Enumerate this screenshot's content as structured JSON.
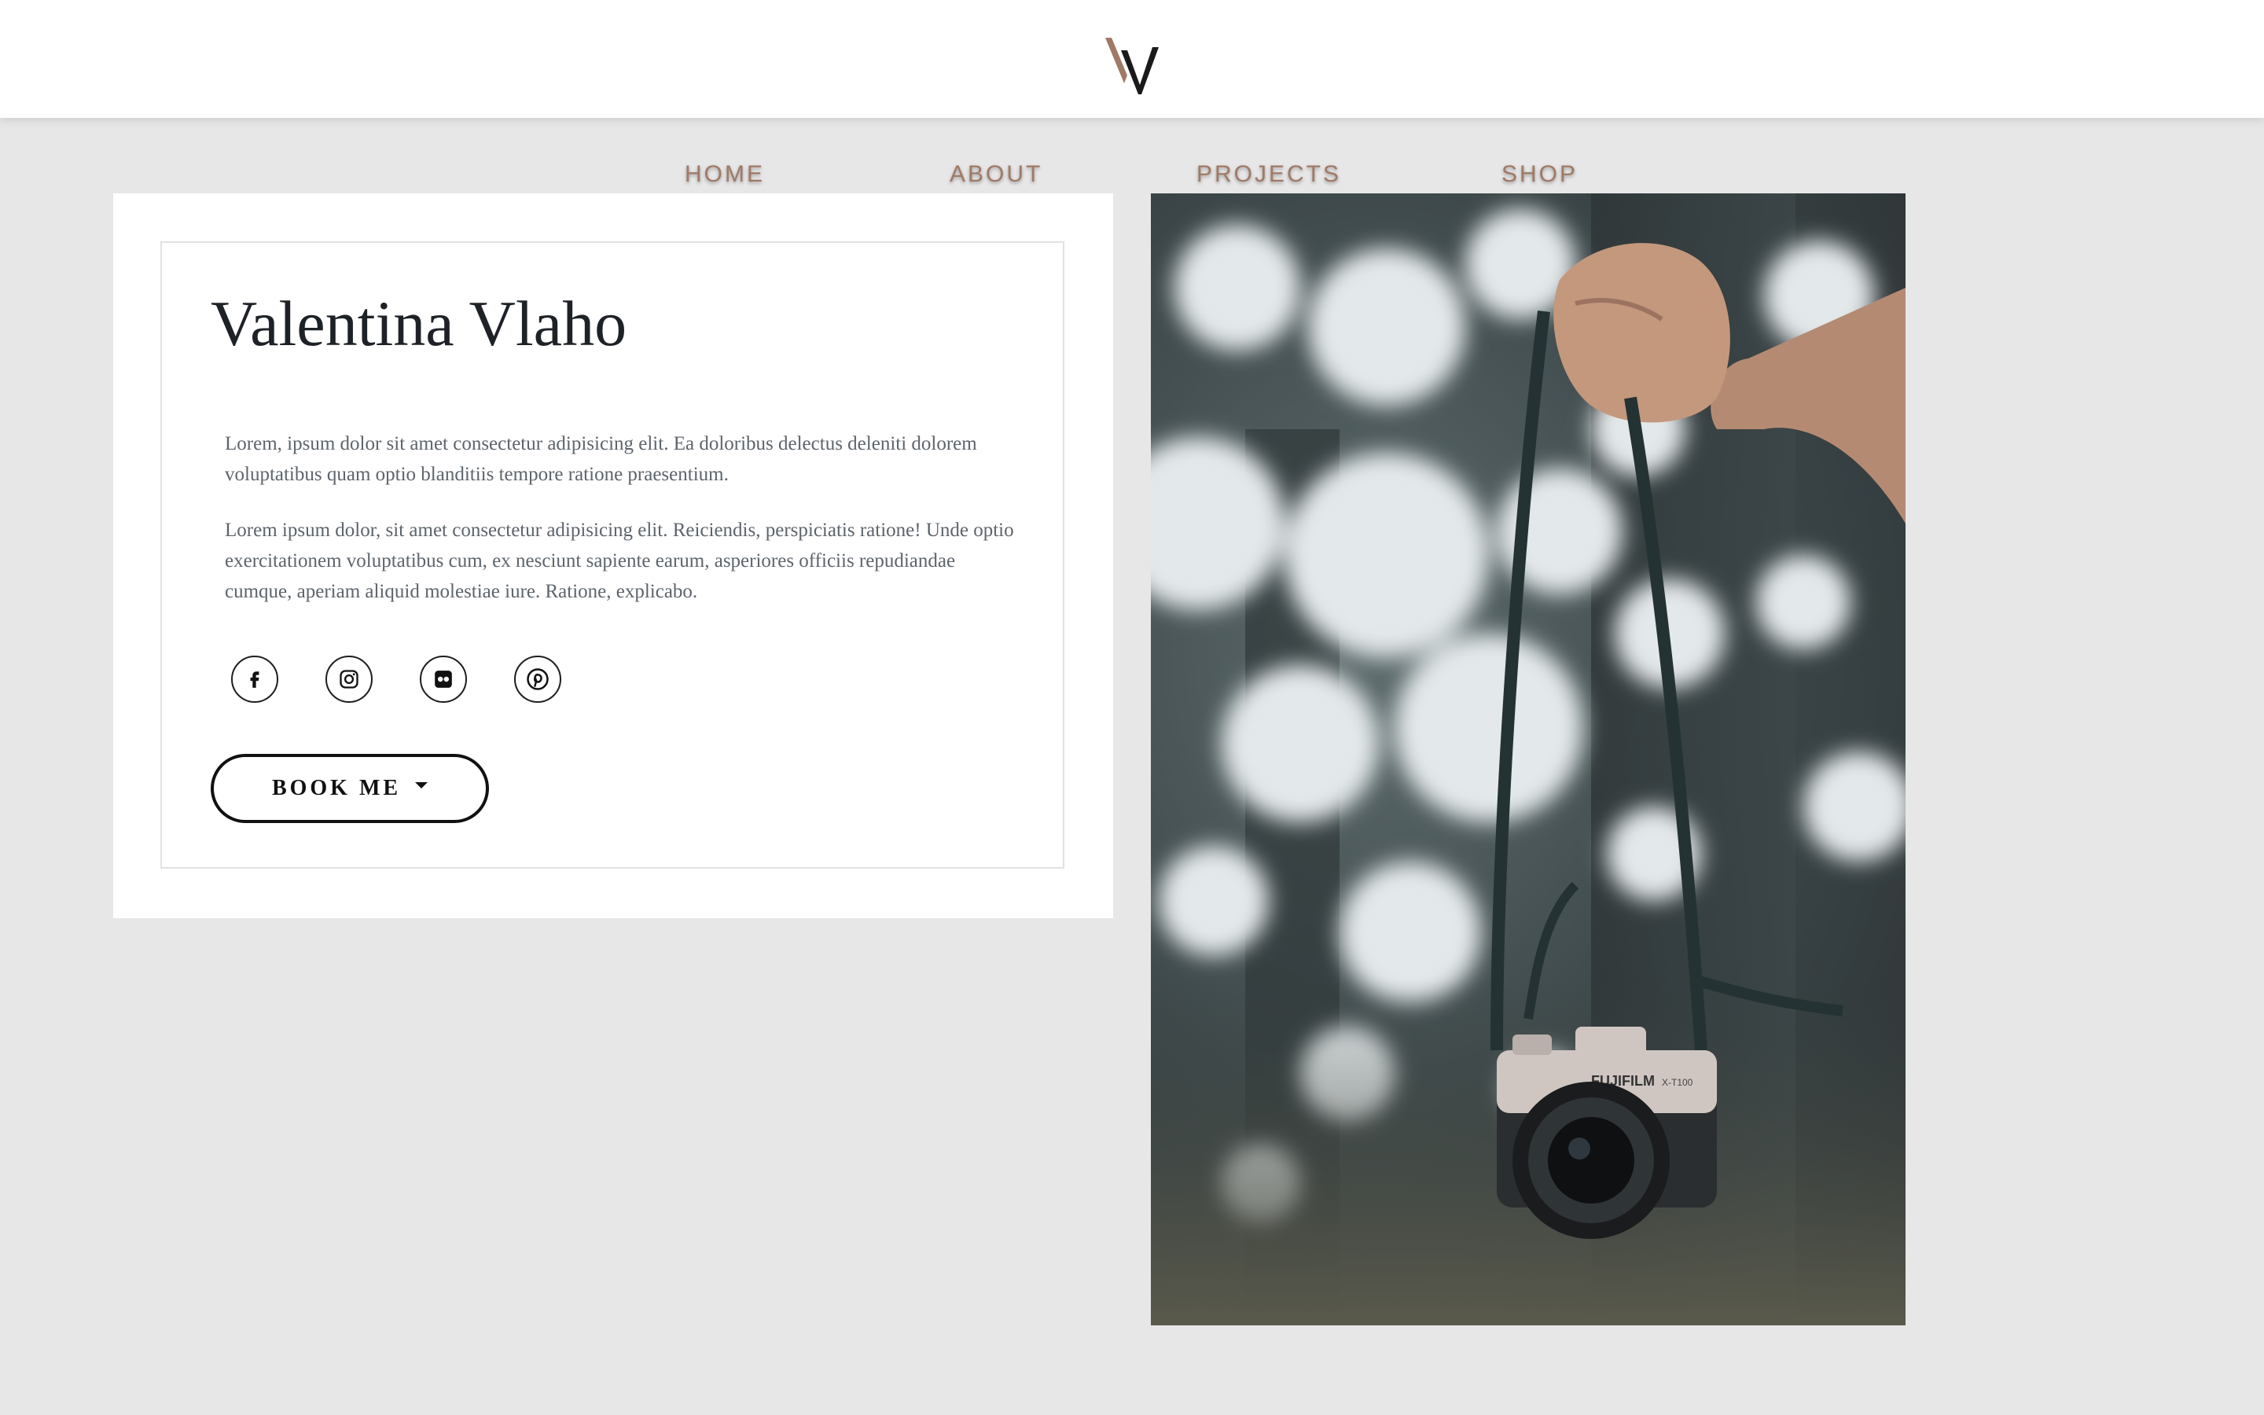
{
  "header": {
    "logo_icon": "vv-monogram-logo",
    "logo_colors": {
      "accent": "#a07a66",
      "dark": "#1a1a1a"
    }
  },
  "nav": {
    "items": [
      {
        "label": "HOME"
      },
      {
        "label": "ABOUT"
      },
      {
        "label": "PROJECTS"
      },
      {
        "label": "SHOP"
      }
    ],
    "color": "#a07a66"
  },
  "profile": {
    "name": "Valentina Vlaho",
    "paragraphs": [
      "Lorem, ipsum dolor sit amet consectetur adipisicing elit. Ea doloribus delectus deleniti dolorem voluptatibus quam optio blanditiis tempore ratione praesentium.",
      "Lorem ipsum dolor, sit amet consectetur adipisicing elit. Reiciendis, perspiciatis ratione! Unde optio exercitationem voluptatibus cum, ex nesciunt sapiente earum, asperiores officiis repudiandae cumque, aperiam aliquid molestiae iure. Ratione, explicabo."
    ],
    "socials": [
      {
        "icon": "facebook-icon"
      },
      {
        "icon": "instagram-icon"
      },
      {
        "icon": "flickr-icon"
      },
      {
        "icon": "pinterest-icon"
      }
    ],
    "book_button": {
      "label": "BOOK ME",
      "icon": "caret-down-icon"
    }
  },
  "hero_image": {
    "subject": "hand holding a camera by its strap against blurred foliage",
    "camera_brand_text": "FUJIFILM",
    "camera_model_text": "X-T100"
  },
  "colors": {
    "background": "#e7e7e7",
    "card": "#ffffff",
    "text_dark": "#1e2227",
    "text_body": "#5d646b"
  }
}
